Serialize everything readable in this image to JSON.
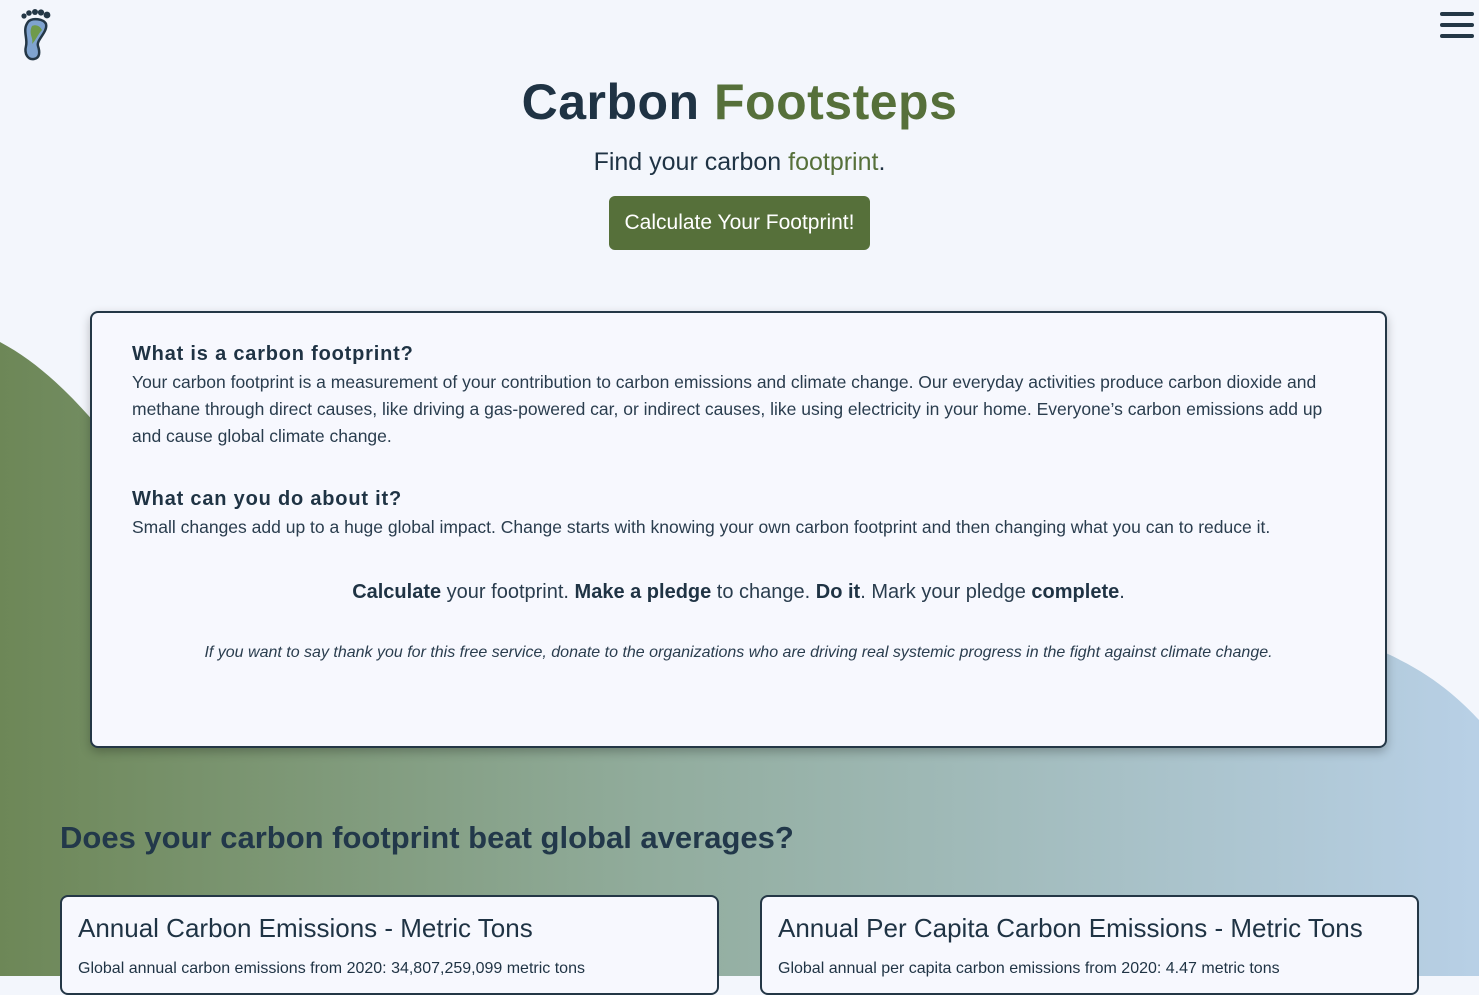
{
  "header": {
    "logo_icon": "footprint-logo-icon",
    "menu_icon": "hamburger-menu-icon"
  },
  "hero": {
    "title_part1": "Carbon",
    "title_part2": "Footsteps",
    "tagline_part1": "Find your carbon ",
    "tagline_highlight": "footprint",
    "tagline_end": ".",
    "cta_label": "Calculate Your Footprint!"
  },
  "info": {
    "q1": "What is a carbon footprint?",
    "a1": "Your carbon footprint is a measurement of your contribution to carbon emissions and climate change. Our everyday activities produce carbon dioxide and methane through direct causes, like driving a gas-powered car, or indirect causes, like using electricity in your home. Everyone’s carbon emissions add up and cause global climate change.",
    "q2": "What can you do about it?",
    "a2": "Small changes add up to a huge global impact. Change starts with knowing your own carbon footprint and then changing what you can to reduce it.",
    "steps": {
      "s1_bold": "Calculate",
      "s1_rest": " your footprint. ",
      "s2_bold": "Make a pledge",
      "s2_rest": " to change. ",
      "s3_bold": "Do it",
      "s3_rest": ". Mark your pledge ",
      "s4_bold": "complete",
      "s4_rest": "."
    },
    "donate_note": "If you want to say thank you for this free service, donate to the organizations who are driving real systemic progress in the fight against climate change."
  },
  "averages": {
    "section_title": "Does your carbon footprint beat global averages?",
    "cards": [
      {
        "title": "Annual Carbon Emissions - Metric Tons",
        "text": "Global annual carbon emissions from 2020: 34,807,259,099 metric tons"
      },
      {
        "title": "Annual Per Capita Carbon Emissions - Metric Tons",
        "text": "Global annual per capita carbon emissions from 2020: 4.47 metric tons"
      }
    ]
  },
  "colors": {
    "brand_green": "#56703a",
    "brand_navy": "#1f3344",
    "page_background": "#f3f6fc"
  }
}
